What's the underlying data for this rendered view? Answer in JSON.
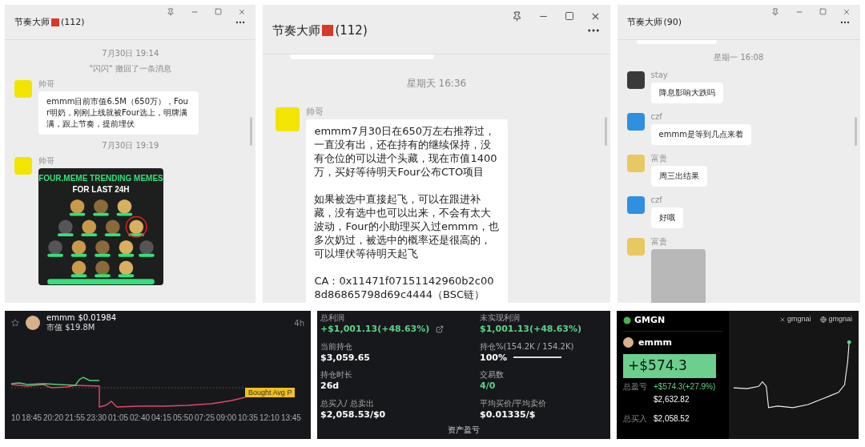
{
  "chats": [
    {
      "title": "节奏大师",
      "badge": true,
      "count": "(112)",
      "items": [
        {
          "kind": "time",
          "text": "7月30日 19:14"
        },
        {
          "kind": "notice",
          "text": "\"闪闪\" 撤回了一条消息"
        },
        {
          "kind": "message",
          "sender": "帅哥",
          "color": "#f2e600",
          "paragraphs": [
            "emmm目前市值6.5M（650万），Four明奶，刚刚上线就被Four选上，明牌满满，跟上节奏，提前埋伏"
          ]
        },
        {
          "kind": "time",
          "text": "7月30日 19:19"
        },
        {
          "kind": "image_message",
          "sender": "帅哥",
          "color": "#f2e600",
          "heading": "FOUR.MEME TRENDING MEMES",
          "subheading": "FOR LAST 24H"
        }
      ]
    },
    {
      "title": "节奏大师",
      "badge": true,
      "count": "(112)",
      "items": [
        {
          "kind": "bubble_edge"
        },
        {
          "kind": "time",
          "text": "星期天 16:36"
        },
        {
          "kind": "message",
          "sender": "帅哥",
          "color": "#f2e600",
          "paragraphs": [
            "emmm7月30日在650万左右推荐过，一直没有出，还在持有的继续保持，没有仓位的可以进个头藏，现在市值1400万，买好等待明天Four公布CTO项目",
            "如果被选中直接起飞，可以在跟进补藏，没有选中也可以出来，不会有太大波动，Four的小助理买入过emmm，也多次奶过，被选中的概率还是很高的，可以埋伏等待明天起飞",
            "CA：0x11471f07151142960b2c008d86865798d69c4444（BSC链）"
          ]
        }
      ]
    },
    {
      "title": "节奏大师",
      "badge": false,
      "count": "(90)",
      "items": [
        {
          "kind": "bubble_edge"
        },
        {
          "kind": "time",
          "text": "星期一 16:08"
        },
        {
          "kind": "message",
          "sender": "stay",
          "color": "#3a3a3a",
          "paragraphs": [
            "降息影响大跌吗"
          ]
        },
        {
          "kind": "message",
          "sender": "czf",
          "color": "#2f8fe0",
          "paragraphs": [
            "emmm是等到几点来着"
          ]
        },
        {
          "kind": "message",
          "sender": "富贵",
          "color": "#e8c860",
          "paragraphs": [
            "周三出结果"
          ]
        },
        {
          "kind": "message",
          "sender": "czf",
          "color": "#2f8fe0",
          "paragraphs": [
            "好哦"
          ]
        },
        {
          "kind": "photo_message",
          "sender": "富贵",
          "color": "#e8c860"
        }
      ]
    }
  ],
  "price_panel": {
    "token": "emmm",
    "price": "$0.01984",
    "market_cap": "市值 $19.8M",
    "interval": "4h",
    "avg_label": "Bought Avg P",
    "time_labels": [
      "10",
      "18:45",
      "20:20",
      "21:55",
      "23:30",
      "01:05",
      "02:40",
      "04:15",
      "05:50",
      "07:25",
      "09:00",
      "10:35",
      "12:10",
      "13:45"
    ]
  },
  "stats_panel": {
    "stats": [
      {
        "label": "总利润",
        "value": "+$1,001.13(+48.63%)",
        "positive": true,
        "link": true
      },
      {
        "label": "未实现利润",
        "value": "$1,001.13(+48.63%)",
        "positive": true,
        "link": false
      },
      {
        "label": "当前持仓",
        "value": "$3,059.65",
        "positive": false,
        "link": false
      },
      {
        "label": "持仓%(154.2K / 154.2K)",
        "value": "100%",
        "positive": false,
        "link": false,
        "level": 1
      },
      {
        "label": "持仓时长",
        "value": "26d",
        "positive": false,
        "link": false
      },
      {
        "label": "交易数",
        "value": "4/0",
        "positive": true,
        "link": false
      },
      {
        "label": "总买入/ 总卖出",
        "value": "$2,058.53/$0",
        "positive": false,
        "link": false
      },
      {
        "label": "平均买价/平均卖价",
        "value": "$0.01335/$",
        "positive": false,
        "link": false
      }
    ],
    "footer": "资产盈亏"
  },
  "share_card": {
    "brand": "GMGN",
    "socials": [
      {
        "kind": "x",
        "text": "gmgnai"
      },
      {
        "kind": "web",
        "text": "gmgnai"
      }
    ],
    "token": "emmm",
    "pnl": "+$574.3",
    "rows": [
      {
        "label": "总盈亏",
        "value": "+$574.3(+27.9%)",
        "positive": true
      },
      {
        "value": "$2,632.82",
        "positive": false
      },
      {
        "label": "总买入",
        "value": "$2,058.52",
        "positive": false
      }
    ]
  }
}
